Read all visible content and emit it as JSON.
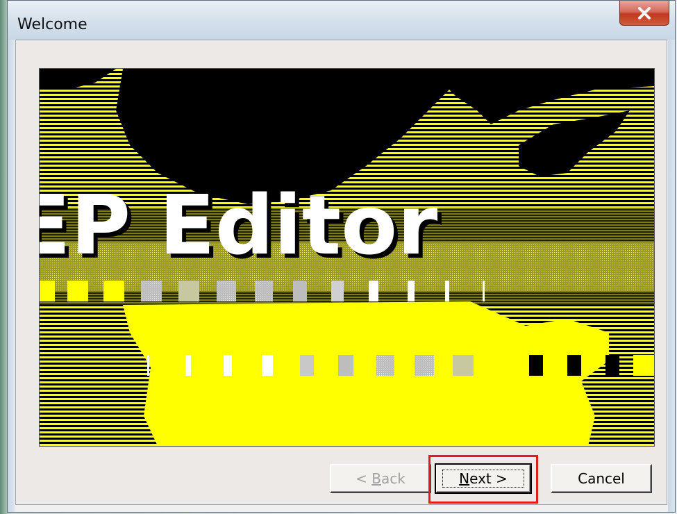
{
  "window": {
    "title": "Welcome",
    "close_label": "x"
  },
  "banner": {
    "title": "EP Editor",
    "colors": {
      "yellow": "#ffff00",
      "olive": "#808000",
      "black": "#000000",
      "white": "#ffffff"
    }
  },
  "buttons": {
    "back_prefix": "< ",
    "back_mnemonic": "B",
    "back_rest": "ack",
    "next_mnemonic": "N",
    "next_rest": "ext >",
    "cancel": "Cancel"
  },
  "annotation": {
    "highlight_color": "#e31b1b",
    "highlighted": "next-button"
  }
}
